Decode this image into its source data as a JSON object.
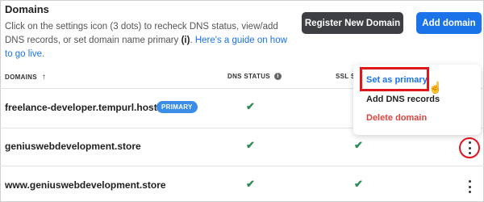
{
  "header": {
    "title": "Domains",
    "description_part1": "Click on the settings icon (3 dots) to recheck DNS status, view/add DNS records, or set domain name primary ",
    "description_bold": "(i)",
    "description_part2": ". ",
    "guide_link": "Here's a guide on how to go live."
  },
  "buttons": {
    "register": "Register New Domain",
    "add": "Add domain"
  },
  "table": {
    "columns": {
      "domains": "DOMAINS",
      "dns_status": "DNS STATUS",
      "ssl_status": "SSL S"
    },
    "rows": [
      {
        "domain": "freelance-developer.tempurl.host",
        "badge": "PRIMARY",
        "dns_ok": "✔",
        "ssl_ok": ""
      },
      {
        "domain": "geniuswebdevelopment.store",
        "badge": "",
        "dns_ok": "✔",
        "ssl_ok": "✔"
      },
      {
        "domain": "www.geniuswebdevelopment.store",
        "badge": "",
        "dns_ok": "✔",
        "ssl_ok": "✔"
      }
    ]
  },
  "context_menu": {
    "items": [
      "Set as primary",
      "Add DNS records",
      "Delete domain"
    ]
  },
  "icons": {
    "sort": "arrow-up-icon",
    "info": "info-icon",
    "kebab": "more-vertical-icon",
    "check": "check-icon",
    "cursor": "hand-pointer-icon"
  },
  "colors": {
    "accent": "#1a73e8",
    "danger": "#e0443e",
    "success": "#2e8b57",
    "highlight": "#e0161d"
  }
}
